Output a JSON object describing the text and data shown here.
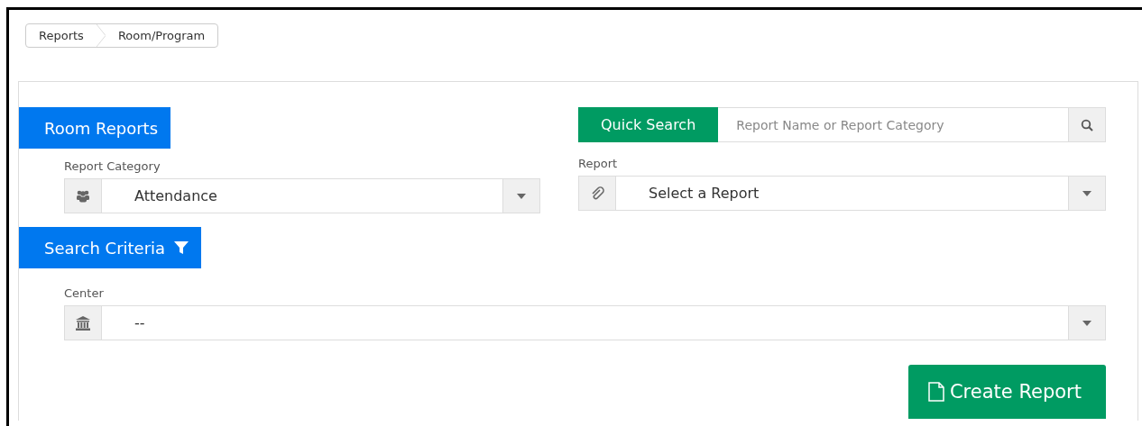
{
  "breadcrumb": [
    {
      "label": "Reports"
    },
    {
      "label": "Room/Program"
    }
  ],
  "room_reports": {
    "title": "Room Reports",
    "report_category": {
      "label": "Report Category",
      "value": "Attendance"
    }
  },
  "quick_search": {
    "button": "Quick Search",
    "placeholder": "Report Name or Report Category"
  },
  "report": {
    "label": "Report",
    "value": "Select a Report"
  },
  "search_criteria": {
    "title": "Search Criteria",
    "center": {
      "label": "Center",
      "value": "--"
    }
  },
  "create_button": "Create Report"
}
